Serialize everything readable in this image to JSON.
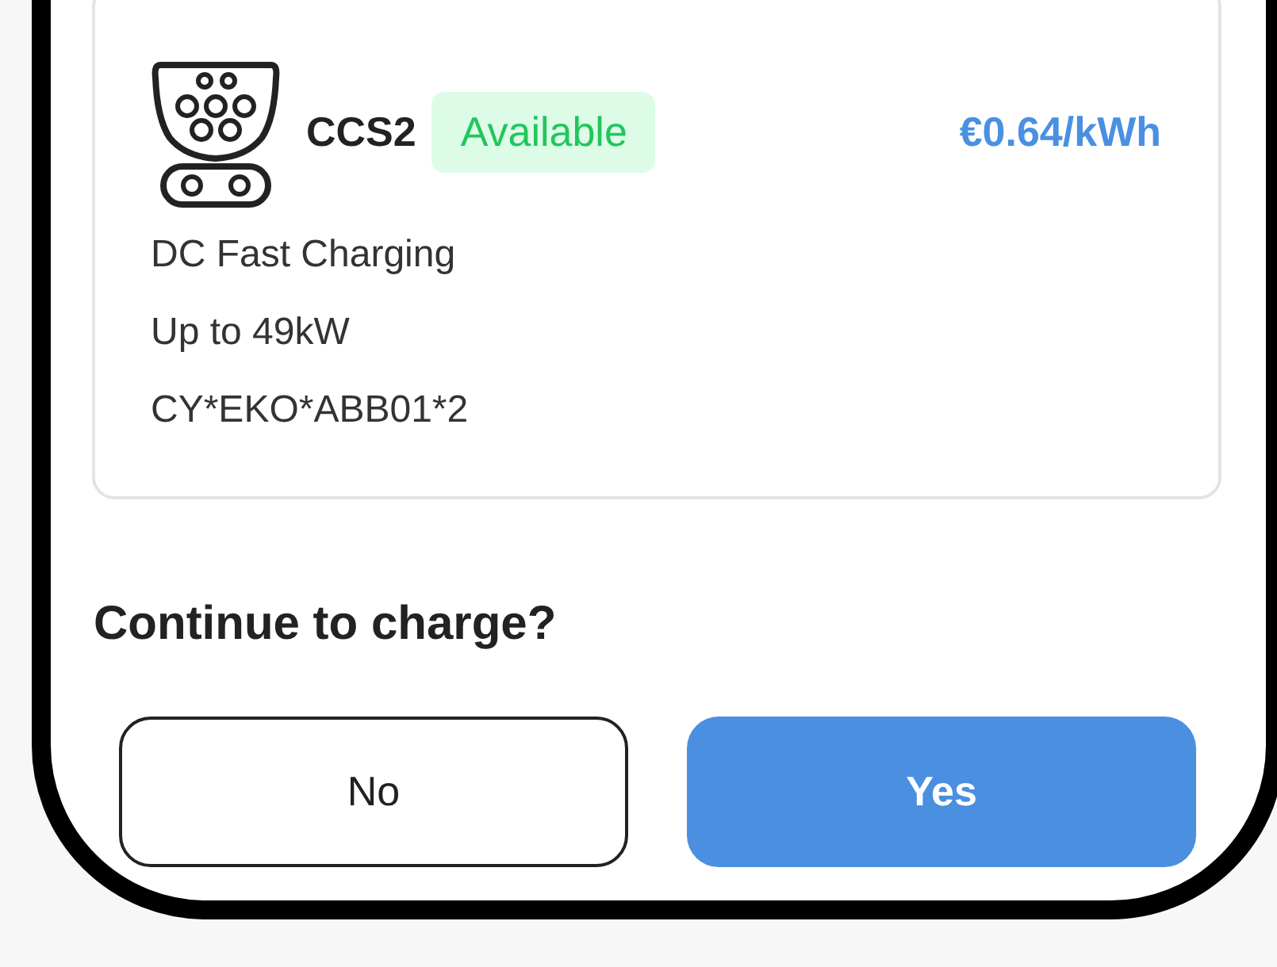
{
  "connector": {
    "name": "CCS2",
    "status": "Available",
    "price": "€0.64/kWh",
    "details": [
      "DC Fast Charging",
      "Up to 49kW",
      "CY*EKO*ABB01*2"
    ]
  },
  "question": "Continue to charge?",
  "buttons": [
    {
      "label": "No",
      "kind": "secondary"
    },
    {
      "label": "Yes",
      "kind": "primary"
    }
  ]
}
